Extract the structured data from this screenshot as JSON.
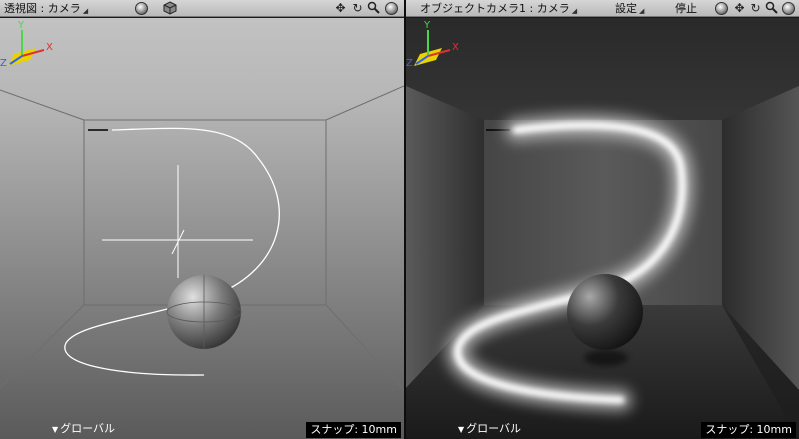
{
  "left_view": {
    "title": "透視図 : カメラ",
    "snap_label": "スナップ: 10mm",
    "coord_mode": "グローバル",
    "axis_y": "Y",
    "axis_x": "X",
    "axis_z": "Z"
  },
  "right_view": {
    "title": "オブジェクトカメラ1 : カメラ",
    "settings": "設定",
    "stop": "停止",
    "snap_label": "スナップ: 10mm",
    "coord_mode": "グローバル",
    "axis_y": "Y",
    "axis_x": "X",
    "axis_z": "Z"
  },
  "colors": {
    "header_bg": "#c8c8c8",
    "axis_x": "#e03030",
    "axis_y": "#4bd64b",
    "axis_z": "#3060ff",
    "axis_plane": "#e8d300"
  },
  "icons": [
    "move-icon",
    "rotate-icon",
    "zoom-icon",
    "fit-icon",
    "camera-target-icon",
    "cube-icon"
  ]
}
